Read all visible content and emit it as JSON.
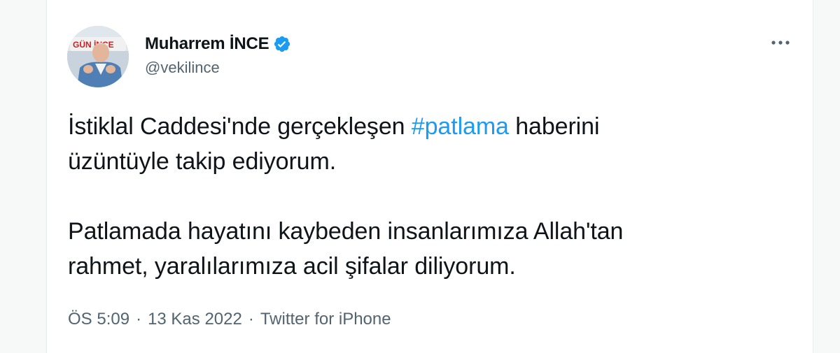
{
  "author": {
    "display_name": "Muharrem İNCE",
    "handle": "@vekilince",
    "verified": true,
    "avatar_banner_text": "GÜN İNCE"
  },
  "more_icon": "more-horizontal-icon",
  "tweet": {
    "line1_before": "İstiklal Caddesi'nde gerçekleşen ",
    "hashtag": "#patlama",
    "line1_after": " haberini",
    "line2": "üzüntüyle takip ediyorum.",
    "para2_line1": "Patlamada hayatını kaybeden insanlarımıza Allah'tan",
    "para2_line2": "rahmet, yaralılarımıza acil şifalar diliyorum."
  },
  "meta": {
    "time": "ÖS 5:09",
    "separator": "·",
    "date": "13 Kas 2022",
    "source": "Twitter for iPhone"
  },
  "colors": {
    "accent": "#1d9bf0",
    "text": "#0f1419",
    "secondary": "#536471"
  }
}
